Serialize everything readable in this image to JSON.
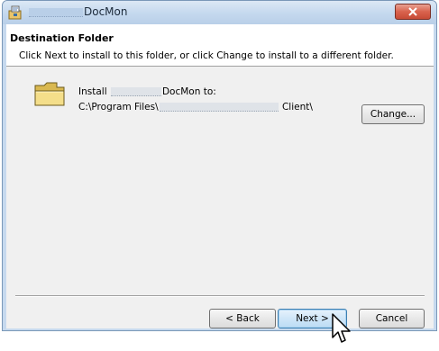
{
  "window": {
    "title_suffix": "DocMon"
  },
  "banner": {
    "title": "Destination Folder",
    "description": "Click Next to install to this folder, or click Change to install to a different folder."
  },
  "install": {
    "prefix": "Install ",
    "suffix": "DocMon to:",
    "path_prefix": "C:\\Program Files\\",
    "path_suffix": " Client\\"
  },
  "buttons": {
    "change": "Change...",
    "back": "< Back",
    "next": "Next >",
    "cancel": "Cancel"
  },
  "icons": {
    "app": "installer-app-icon",
    "folder": "folder-icon",
    "close": "close-icon",
    "cursor": "mouse-pointer-icon"
  },
  "colors": {
    "titlebar": "#c4d8ee",
    "close_button": "#d9624d",
    "focus_button": "#3c7fb1"
  }
}
